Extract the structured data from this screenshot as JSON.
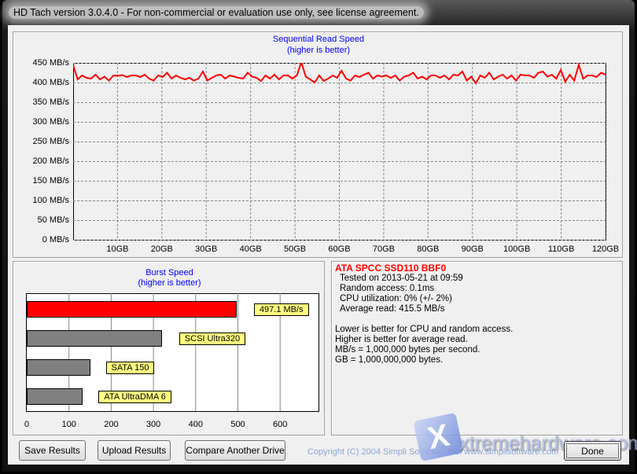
{
  "window": {
    "title": "HD Tach version 3.0.4.0  - For non-commercial or evaluation use only, see license agreement."
  },
  "sequential": {
    "chart_data": {
      "type": "line",
      "title": "Sequential Read Speed",
      "subtitle": "(higher is better)",
      "ylim": [
        0,
        450
      ],
      "xlim": [
        0,
        120
      ],
      "y_ticks": [
        "450 MB/s",
        "400 MB/s",
        "350 MB/s",
        "300 MB/s",
        "250 MB/s",
        "200 MB/s",
        "150 MB/s",
        "100 MB/s",
        "50 MB/s",
        "0 MB/s"
      ],
      "x_ticks": [
        "10GB",
        "20GB",
        "30GB",
        "40GB",
        "50GB",
        "60GB",
        "70GB",
        "80GB",
        "90GB",
        "100GB",
        "110GB",
        "120GB"
      ],
      "grid": true,
      "color": "#ff0000",
      "y": [
        445,
        408,
        418,
        412,
        410,
        420,
        408,
        415,
        405,
        418,
        417,
        419,
        414,
        418,
        418,
        414,
        420,
        410,
        405,
        418,
        414,
        425,
        410,
        418,
        412,
        408,
        412,
        405,
        410,
        428,
        405,
        412,
        418,
        420,
        410,
        418,
        415,
        412,
        410,
        425,
        415,
        412,
        404,
        418,
        410,
        420,
        408,
        418,
        418,
        410,
        418,
        452,
        415,
        408,
        400,
        418,
        404,
        410,
        418,
        412,
        430,
        410,
        405,
        418,
        414,
        420,
        425,
        410,
        418,
        415,
        418,
        412,
        418,
        405,
        415,
        418,
        425,
        410,
        415,
        408,
        418,
        418,
        412,
        418,
        408,
        420,
        418,
        428,
        405,
        415,
        398,
        418,
        412,
        425,
        408,
        415,
        420,
        410,
        418,
        405,
        420,
        418,
        418,
        412,
        425,
        428,
        415,
        420,
        410,
        432,
        402,
        420,
        405,
        445,
        410,
        418,
        418,
        414,
        425,
        420
      ]
    }
  },
  "burst": {
    "chart_data": {
      "type": "bar",
      "title": "Burst Speed",
      "subtitle": "(higher is better)",
      "xlim": [
        0,
        700
      ],
      "x_ticks": [
        "0",
        "100",
        "200",
        "300",
        "400",
        "500",
        "600"
      ],
      "grid": true,
      "bars": [
        {
          "label": "497.1 MB/s",
          "value": 497.1,
          "color": "#ff0000"
        },
        {
          "label": "SCSI Ultra320",
          "value": 320,
          "color": "#808080"
        },
        {
          "label": "SATA 150",
          "value": 150,
          "color": "#808080"
        },
        {
          "label": "ATA UltraDMA 6",
          "value": 133,
          "color": "#808080"
        }
      ]
    }
  },
  "info": {
    "drive": "ATA SPCC SSD110 BBF0",
    "lines": [
      "Tested on 2013-05-21 at 09:59",
      "Random access: 0.1ms",
      "CPU utilization: 0% (+/- 2%)",
      "Average read: 415.5 MB/s"
    ],
    "notes": [
      "Lower is better for CPU and random access.",
      "Higher is better for average read.",
      "MB/s = 1,000,000 bytes per second.",
      "GB = 1,000,000,000 bytes."
    ]
  },
  "buttons": {
    "save": "Save Results",
    "upload": "Upload Results",
    "compare": "Compare Another Drive",
    "done": "Done"
  },
  "footer": {
    "copyright": "Copyright (C) 2004 Simpli Software, Inc. www.simplisoftware.com",
    "watermark": "xtremehardware.com"
  }
}
